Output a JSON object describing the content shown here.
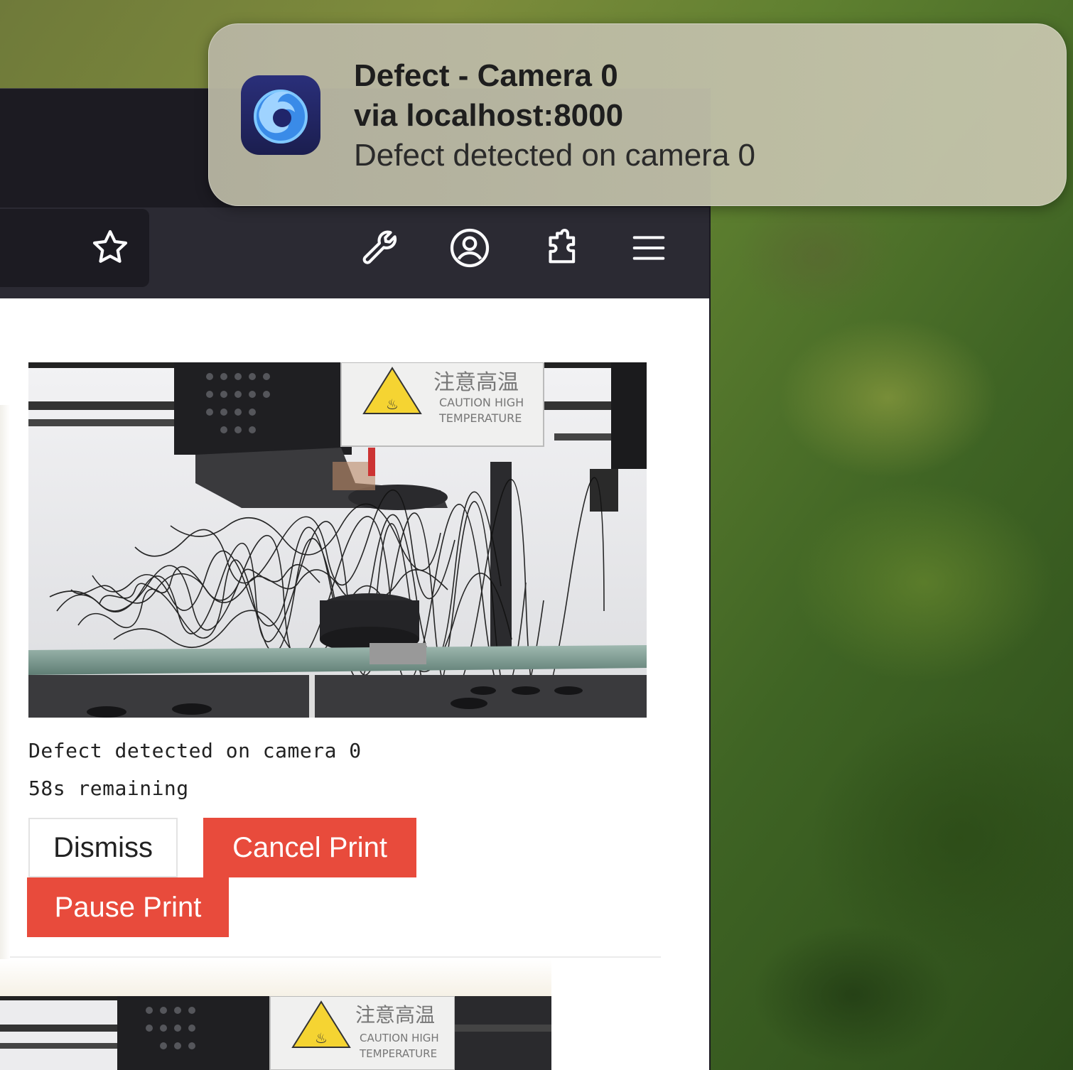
{
  "notification": {
    "title": "Defect - Camera 0",
    "subtitle": "via localhost:8000",
    "body": "Defect detected on camera 0",
    "app_icon": "firefox-developer-edition-icon"
  },
  "toolbar": {
    "icons": [
      "star-icon",
      "wrench-icon",
      "account-icon",
      "extensions-icon",
      "menu-icon"
    ]
  },
  "alert": {
    "message": "Defect detected on camera 0",
    "countdown": "58s remaining",
    "dismiss_label": "Dismiss",
    "cancel_label": "Cancel Print",
    "pause_label": "Pause Print"
  },
  "camera_image": {
    "label_cn": "注意高温",
    "label_line1": "CAUTION HIGH",
    "label_line2": "TEMPERATURE"
  },
  "colors": {
    "danger": "#e84b3c",
    "toolbar_bg": "#2b2a33",
    "tabstrip_bg": "#1c1b22"
  }
}
